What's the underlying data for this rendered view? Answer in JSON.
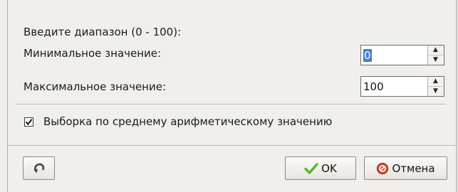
{
  "dialog": {
    "range_prompt": "Введите диапазон (0 - 100):",
    "min": {
      "label": "Минимальное значение:",
      "value": "0",
      "selected": true
    },
    "max": {
      "label": "Максимальное значение:",
      "value": "100"
    },
    "average_sampling": {
      "label": "Выборка по среднему арифметическому значению",
      "checked": true
    }
  },
  "buttons": {
    "undo_icon": "undo-arrow-icon",
    "ok_label": "OK",
    "ok_icon": "checkmark-icon",
    "cancel_label": "Отмена",
    "cancel_icon": "cancel-circle-icon"
  },
  "colors": {
    "selection": "#4a7fce",
    "ok_icon": "#5bb52b",
    "cancel_icon": "#d9462a"
  }
}
